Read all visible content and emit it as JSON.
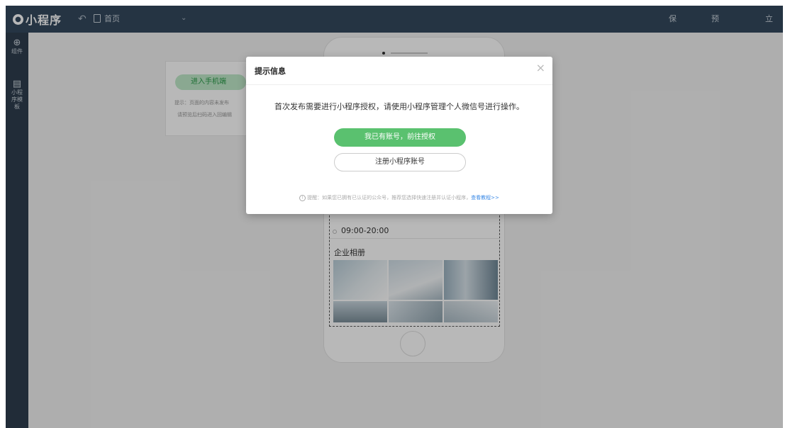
{
  "topbar": {
    "logo_text": "小程序",
    "undo_icon": "↶",
    "page_label": "首页",
    "page_caret": "⌄",
    "save_label": "保存",
    "preview_label": "预览",
    "publish_label": "立即发布"
  },
  "sidebar": {
    "items": [
      {
        "icon": "⊕",
        "label": "组件"
      },
      {
        "icon": "▤",
        "label": "小程序模板"
      }
    ]
  },
  "left_panel": {
    "enter_button": "进入手机端",
    "hint_line1": "提示：页面的内容未发布",
    "hint_line2": "请预览后扫码进入回编辑"
  },
  "phone": {
    "hours": "09:00-20:00",
    "album_title": "企业相册"
  },
  "dialog": {
    "title": "提示信息",
    "close_icon": "×",
    "message": "首次发布需要进行小程序授权，请使用小程序管理个人微信号进行操作。",
    "auth_button": "我已有账号，前往授权",
    "register_button": "注册小程序账号",
    "tip_text": "提醒：如果您已拥有已认证的公众号，推荐您选择快速注册并认证小程序，",
    "tip_link": "查看教程>>"
  }
}
